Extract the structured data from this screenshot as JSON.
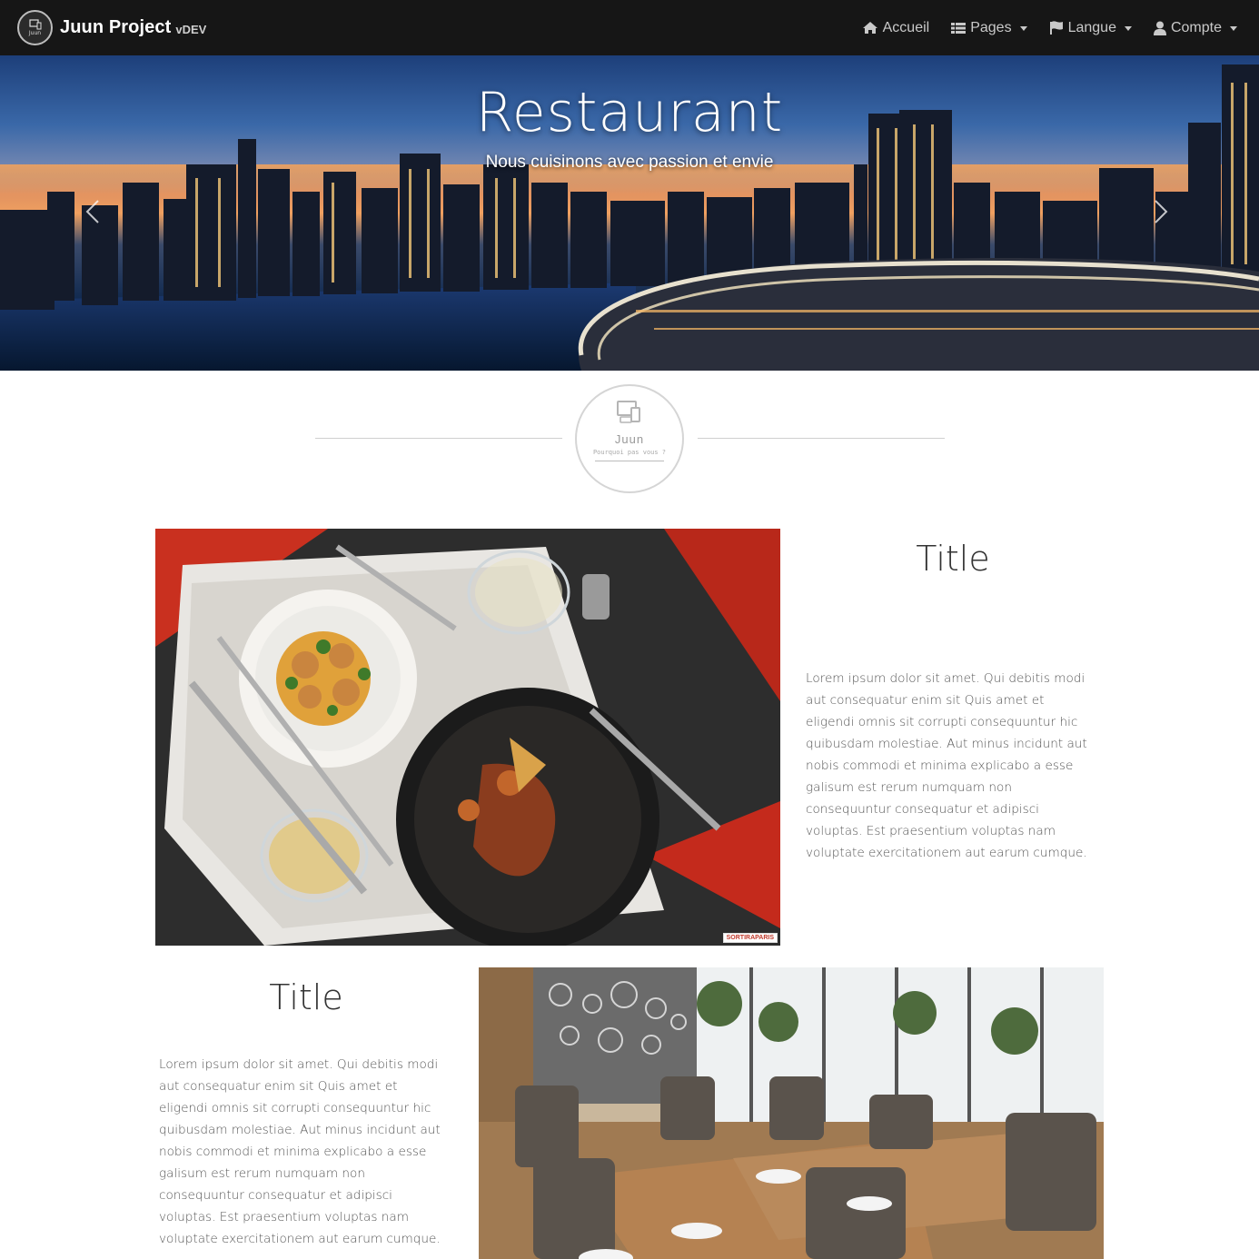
{
  "navbar": {
    "brand_name": "Juun Project",
    "brand_version": "vDEV",
    "items": [
      {
        "label": "Accueil",
        "icon": "home-icon",
        "dropdown": false
      },
      {
        "label": "Pages",
        "icon": "list-icon",
        "dropdown": true
      },
      {
        "label": "Langue",
        "icon": "flag-icon",
        "dropdown": true
      },
      {
        "label": "Compte",
        "icon": "user-icon",
        "dropdown": true
      }
    ]
  },
  "hero": {
    "title": "Restaurant",
    "subtitle": "Nous cuisinons avec passion et envie"
  },
  "emblem": {
    "name": "Juun",
    "tagline": "Pourquoi pas vous ?"
  },
  "sections": [
    {
      "title": "Title",
      "text": "Lorem ipsum dolor sit amet. Qui debitis modi aut consequatur enim sit Quis amet et eligendi omnis sit corrupti consequuntur hic quibusdam molestiae. Aut minus incidunt aut nobis commodi et minima explicabo a esse galisum est rerum numquam non consequuntur consequatur et adipisci voluptas. Est praesentium voluptas nam voluptate exercitationem aut earum cumque.",
      "image_badge": "SORTIRAPARIS"
    },
    {
      "title": "Title",
      "text": "Lorem ipsum dolor sit amet. Qui debitis modi aut consequatur enim sit Quis amet et eligendi omnis sit corrupti consequuntur hic quibusdam molestiae. Aut minus incidunt aut nobis commodi et minima explicabo a esse galisum est rerum numquam non consequuntur consequatur et adipisci voluptas. Est praesentium voluptas nam voluptate exercitationem aut earum cumque."
    }
  ],
  "colors": {
    "navbar_bg": "#161616",
    "nav_text": "#c9c9c9",
    "page_bg": "#ffffff"
  }
}
